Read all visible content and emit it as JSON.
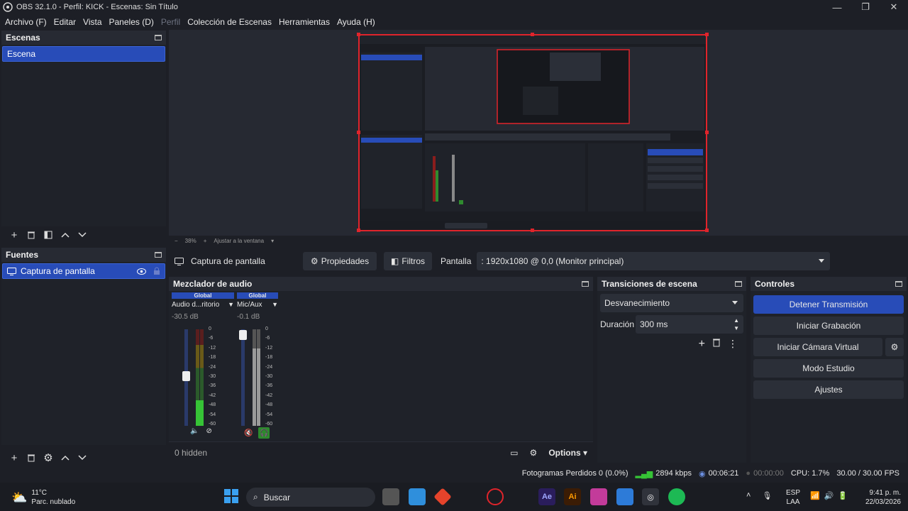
{
  "window": {
    "title": "OBS 32.1.0 - Perfil: KICK - Escenas: Sin Título"
  },
  "menu": [
    "Archivo (F)",
    "Editar",
    "Vista",
    "Paneles (D)",
    "Perfil",
    "Colección de Escenas",
    "Herramientas",
    "Ayuda (H)"
  ],
  "scenes": {
    "title": "Escenas",
    "items": [
      "Escena"
    ]
  },
  "sources": {
    "title": "Fuentes",
    "items": [
      "Captura de pantalla"
    ]
  },
  "zoom": {
    "minus": "−",
    "value": "38%",
    "plus": "+",
    "fit": "Ajustar a la ventana"
  },
  "source_toolbar": {
    "name": "Captura de pantalla",
    "properties": "Propiedades",
    "filters": "Filtros",
    "screen_label": "Pantalla",
    "screen_value": ": 1920x1080 @ 0,0 (Monitor principal)"
  },
  "mixer": {
    "title": "Mezclador de audio",
    "channels": [
      {
        "tag": "Global",
        "name": "Audio d...ritorio",
        "db": "-30.5 dB",
        "level": 0.55
      },
      {
        "tag": "Global",
        "name": "Mic/Aux",
        "db": "-0.1 dB",
        "level": 0.98
      }
    ],
    "scale": [
      "0",
      "-6",
      "-12",
      "-18",
      "-24",
      "-30",
      "-36",
      "-42",
      "-48",
      "-54",
      "-60"
    ],
    "hidden": "0 hidden",
    "options": "Options"
  },
  "transitions": {
    "title": "Transiciones de escena",
    "transition": "Desvanecimiento",
    "duration_label": "Duración",
    "duration_value": "300 ms"
  },
  "controls": {
    "title": "Controles",
    "stop_stream": "Detener Transmisión",
    "start_recording": "Iniciar Grabación",
    "start_virtual_cam": "Iniciar Cámara Virtual",
    "studio_mode": "Modo Estudio",
    "settings": "Ajustes"
  },
  "status": {
    "dropped": "Fotogramas Perdidos 0 (0.0%)",
    "bitrate": "2894 kbps",
    "stream_time": "00:06:21",
    "rec_time": "00:00:00",
    "cpu": "CPU: 1.7%",
    "fps": "30.00 / 30.00 FPS"
  },
  "taskbar": {
    "weather_temp": "11°C",
    "weather_desc": "Parc. nublado",
    "search": "Buscar",
    "lang_top": "ESP",
    "lang_bottom": "LAA",
    "time": "9:41 p. m.",
    "date": "22/03/2026"
  },
  "colors": {
    "accent": "#284cb8",
    "record": "#e0242b",
    "bg": "#1d1f26"
  }
}
